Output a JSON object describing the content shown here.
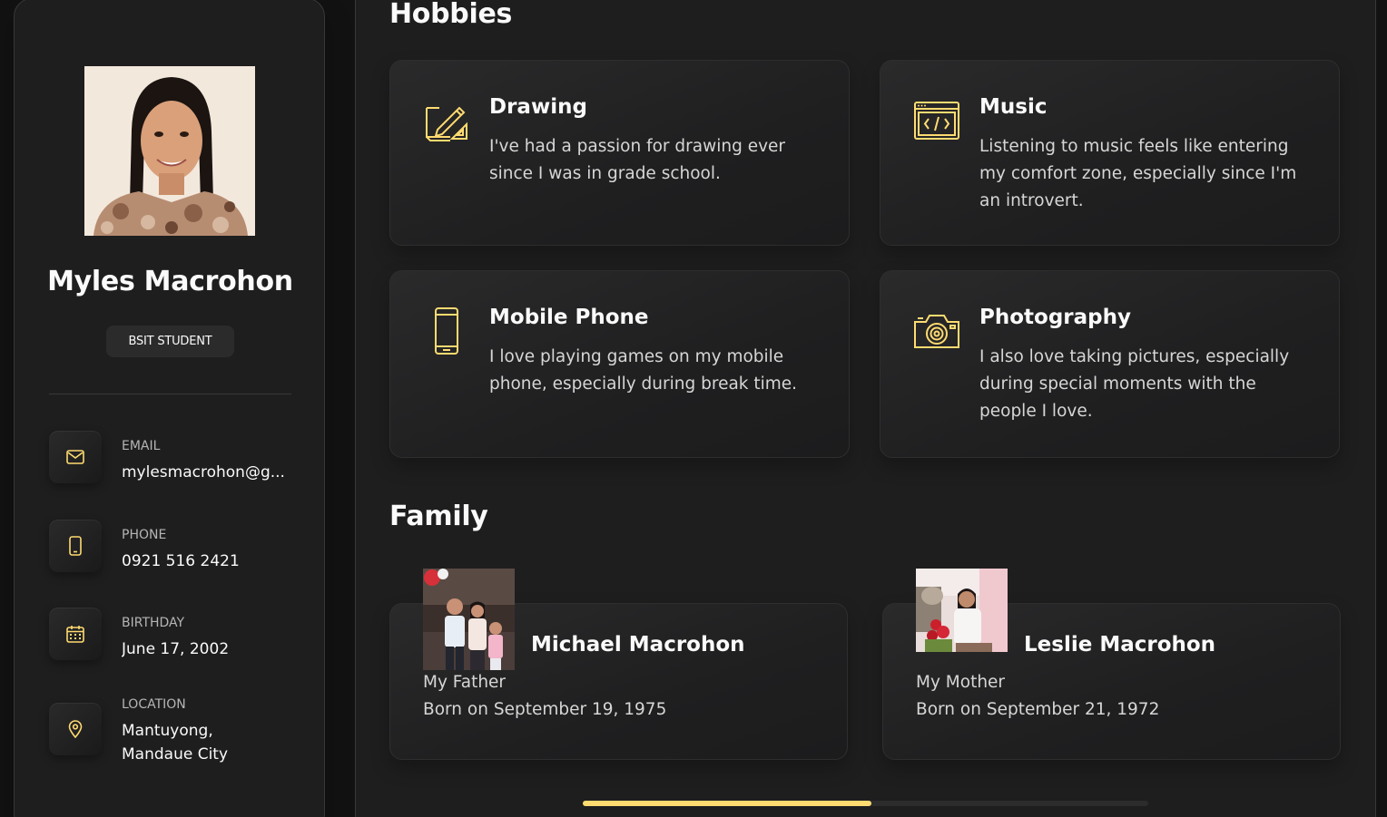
{
  "accent": "#ffdb70",
  "profile": {
    "name": "Myles Macrohon",
    "title": "BSIT STUDENT"
  },
  "contacts": [
    {
      "label": "EMAIL",
      "value": "mylesmacrohon@g...",
      "icon": "mail-icon"
    },
    {
      "label": "PHONE",
      "value": "0921 516 2421",
      "icon": "phone-icon"
    },
    {
      "label": "BIRTHDAY",
      "value": "June 17, 2002",
      "icon": "calendar-icon"
    },
    {
      "label": "LOCATION",
      "value": "Mantuyong, Mandaue City",
      "icon": "location-pin-icon"
    }
  ],
  "hobbies": {
    "title": "Hobbies",
    "items": [
      {
        "title": "Drawing",
        "text": "I've had a passion for drawing ever since I was in grade school.",
        "icon": "drawing-icon"
      },
      {
        "title": "Music",
        "text": "Listening to music feels like entering my comfort zone, especially since I'm an introvert.",
        "icon": "code-window-icon"
      },
      {
        "title": "Mobile Phone",
        "text": "I love playing games on my mobile phone, especially during break time.",
        "icon": "mobile-phone-icon"
      },
      {
        "title": "Photography",
        "text": "I also love taking pictures, especially during special moments with the people I love.",
        "icon": "camera-icon"
      }
    ]
  },
  "family": {
    "title": "Family",
    "members": [
      {
        "name": "Michael Macrohon",
        "relation": "My Father",
        "born": "Born on September 19, 1975"
      },
      {
        "name": "Leslie Macrohon",
        "relation": "My Mother",
        "born": "Born on September 21, 1972"
      }
    ]
  },
  "scroll": {
    "position": 0.51
  }
}
